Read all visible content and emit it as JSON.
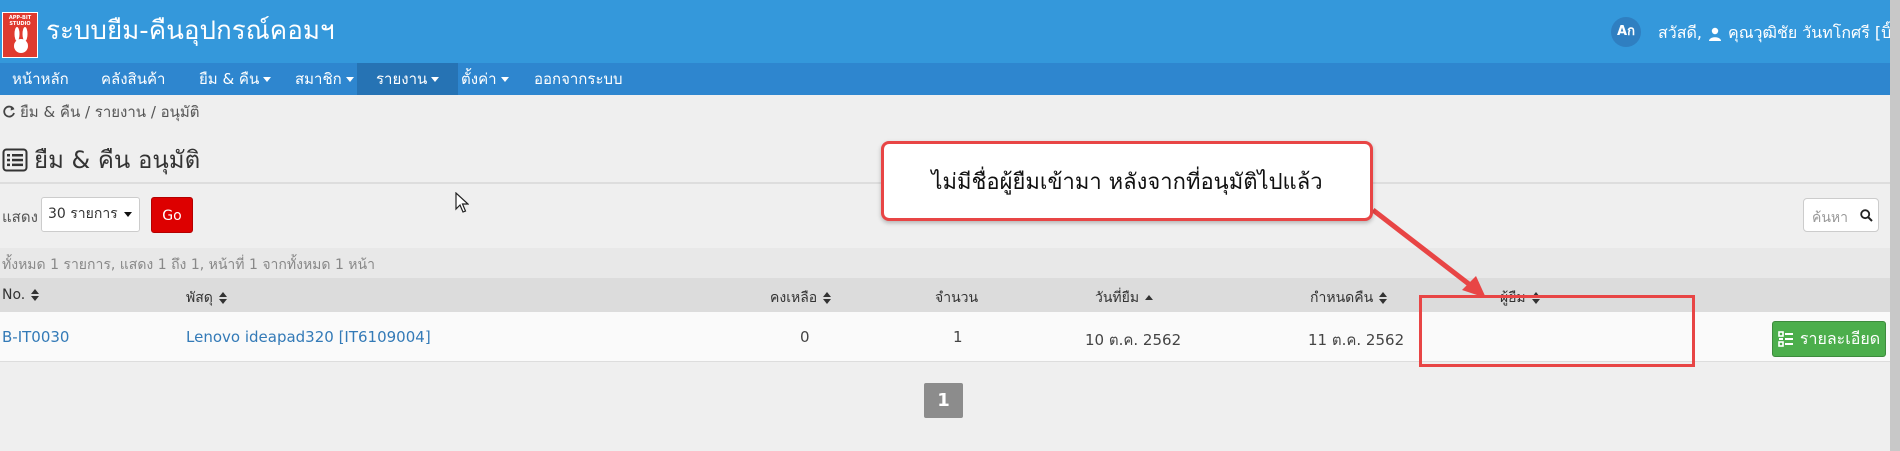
{
  "header": {
    "logo_text": "APP-BIT STUDIO",
    "title": "ระบบยืม-คืนอุปกรณ์คอมฯ",
    "account_badge": "Aก",
    "greeting": "สวัสดี,",
    "user_name": "คุณวุฒิชัย วันทโกศรี [บิ๊ก]"
  },
  "nav": {
    "items": [
      {
        "label": "หน้าหลัก"
      },
      {
        "label": "คลังสินค้า"
      },
      {
        "label": "ยืม & คืน"
      },
      {
        "label": "สมาชิก"
      },
      {
        "label": "รายงาน"
      },
      {
        "label": "ตั้งค่า"
      },
      {
        "label": "ออกจากระบบ"
      }
    ]
  },
  "breadcrumb": "ยืม & คืน / รายงาน / อนุมัติ",
  "page_title": "ยืม & คืน อนุมัติ",
  "controls": {
    "show_label": "แสดง",
    "page_size": "30 รายการ",
    "go_label": "Go",
    "search_placeholder": "ค้นหา"
  },
  "summary": "ทั้งหมด 1 รายการ, แสดง 1 ถึง 1, หน้าที่ 1 จากทั้งหมด 1 หน้า",
  "table": {
    "columns": [
      "No.",
      "พัสดุ",
      "คงเหลือ",
      "จำนวน",
      "วันที่ยืม",
      "กำหนดคืน",
      "ผู้ยืม"
    ],
    "rows": [
      {
        "no": "B-IT0030",
        "item": "Lenovo ideapad320 [IT6109004]",
        "remaining": "0",
        "qty": "1",
        "borrow_date": "10 ต.ค. 2562",
        "due_date": "11 ต.ค. 2562",
        "borrower": "",
        "action": "รายละเอียด"
      }
    ]
  },
  "pagination": {
    "current": "1"
  },
  "annotation": {
    "text": "ไม่มีชื่อผู้ยืมเข้ามา หลังจากที่อนุมัติไปแล้ว",
    "color": "#e84545"
  },
  "colors": {
    "header_bg": "#3498db",
    "nav_bg": "#2e86cf",
    "go_button": "#dd0000",
    "detail_button": "#4cae4c",
    "link": "#337ab7"
  }
}
